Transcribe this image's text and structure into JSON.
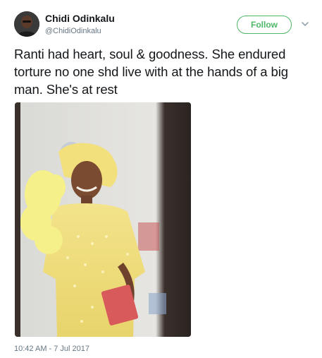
{
  "author": {
    "display_name": "Chidi Odinkalu",
    "handle": "@ChidiOdinkalu"
  },
  "actions": {
    "follow_label": "Follow"
  },
  "tweet": {
    "text": "Ranti had heart, soul & goodness. She endured torture no one shd live with at the hands of a big man. She's at rest",
    "timestamp": "10:42 AM - 7 Jul 2017"
  },
  "colors": {
    "follow_green": "#4db865",
    "secondary_text": "#657786",
    "primary_text": "#14171a"
  },
  "icons": {
    "caret": "chevron-down-icon"
  }
}
